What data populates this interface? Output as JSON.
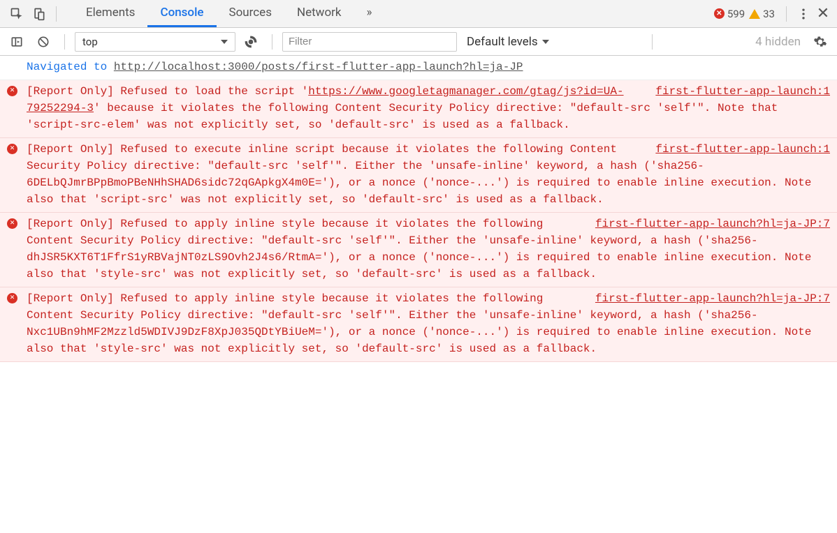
{
  "tabbar": {
    "tabs": [
      "Elements",
      "Console",
      "Sources",
      "Network"
    ],
    "active_index": 1,
    "overflow_glyph": "»",
    "error_count": "599",
    "warn_count": "33"
  },
  "toolbar": {
    "context": "top",
    "filter_placeholder": "Filter",
    "levels_label": "Default levels",
    "hidden_label": "4 hidden"
  },
  "logs": [
    {
      "type": "nav",
      "prefix": "Navigated to ",
      "url": "http://localhost:3000/posts/first-flutter-app-launch?hl=ja-JP"
    },
    {
      "type": "err",
      "source": "first-flutter-app-launch:1",
      "pre_link": "[Report Only] Refused to load the script '",
      "link": "https://www.googletagmanager.com/gtag/js?id=UA-79252294-3",
      "post_link": "' because it violates the following Content Security Policy directive: \"default-src 'self'\". Note that 'script-src-elem' was not explicitly set, so 'default-src' is used as a fallback."
    },
    {
      "type": "err",
      "source": "first-flutter-app-launch:1",
      "text": "[Report Only] Refused to execute inline script because it violates the following Content Security Policy directive: \"default-src 'self'\". Either the 'unsafe-inline' keyword, a hash ('sha256-6DELbQJmrBPpBmoPBeNHhSHAD6sidc72qGApkgX4m0E='), or a nonce ('nonce-...') is required to enable inline execution. Note also that 'script-src' was not explicitly set, so 'default-src' is used as a fallback."
    },
    {
      "type": "err",
      "source": "first-flutter-app-launch?hl=ja-JP:7",
      "text": "[Report Only] Refused to apply inline style because it violates the following Content Security Policy directive: \"default-src 'self'\". Either the 'unsafe-inline' keyword, a hash ('sha256-dhJSR5KXT6T1FfrS1yRBVajNT0zLS9Ovh2J4s6/RtmA='), or a nonce ('nonce-...') is required to enable inline execution. Note also that 'style-src' was not explicitly set, so 'default-src' is used as a fallback."
    },
    {
      "type": "err",
      "source": "first-flutter-app-launch?hl=ja-JP:7",
      "text": "[Report Only] Refused to apply inline style because it violates the following Content Security Policy directive: \"default-src 'self'\". Either the 'unsafe-inline' keyword, a hash ('sha256-Nxc1UBn9hMF2Mzzld5WDIVJ9DzF8XpJ035QDtYBiUeM='), or a nonce ('nonce-...') is required to enable inline execution. Note also that 'style-src' was not explicitly set, so 'default-src' is used as a fallback."
    }
  ]
}
